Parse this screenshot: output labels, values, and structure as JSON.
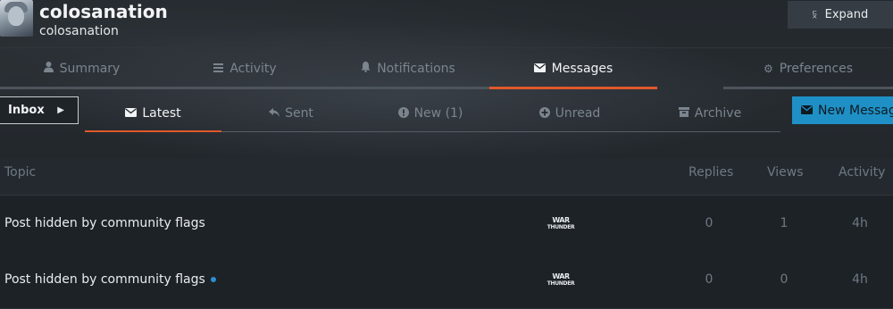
{
  "profile": {
    "username": "colosanation",
    "subname": "colosanation",
    "expand_label": "Expand",
    "expand_icon": "double-chevron-down-icon"
  },
  "main_tabs": [
    {
      "label": "Summary",
      "icon": "user-icon",
      "active": false
    },
    {
      "label": "Activity",
      "icon": "list-icon",
      "active": false
    },
    {
      "label": "Notifications",
      "icon": "bell-icon",
      "active": false
    },
    {
      "label": "Messages",
      "icon": "envelope-icon",
      "active": true
    },
    {
      "label": "Preferences",
      "icon": "gear-icon",
      "active": false
    }
  ],
  "inbox": {
    "label": "Inbox",
    "icon": "caret-right-icon"
  },
  "sub_tabs": [
    {
      "label": "Latest",
      "icon": "envelope-icon",
      "active": true
    },
    {
      "label": "Sent",
      "icon": "reply-icon",
      "active": false
    },
    {
      "label": "New (1)",
      "icon": "exclamation-circle-icon",
      "active": false
    },
    {
      "label": "Unread",
      "icon": "plus-circle-icon",
      "active": false
    },
    {
      "label": "Archive",
      "icon": "archive-icon",
      "active": false
    }
  ],
  "new_message": {
    "label": "New Message",
    "icon": "envelope-icon"
  },
  "table": {
    "headers": {
      "topic": "Topic",
      "replies": "Replies",
      "views": "Views",
      "activity": "Activity"
    },
    "rows": [
      {
        "topic": "Post hidden by community flags",
        "unread": false,
        "replies": "0",
        "views": "1",
        "activity": "4h",
        "avatar_top": "WAR",
        "avatar_bottom": "THUNDER"
      },
      {
        "topic": "Post hidden by community flags",
        "unread": true,
        "replies": "0",
        "views": "0",
        "activity": "4h",
        "avatar_top": "WAR",
        "avatar_bottom": "THUNDER"
      }
    ]
  },
  "colors": {
    "accent": "#e0582b",
    "button_blue": "#1f90c6",
    "unread_dot": "#2b8fd1",
    "background": "#1c2126"
  }
}
